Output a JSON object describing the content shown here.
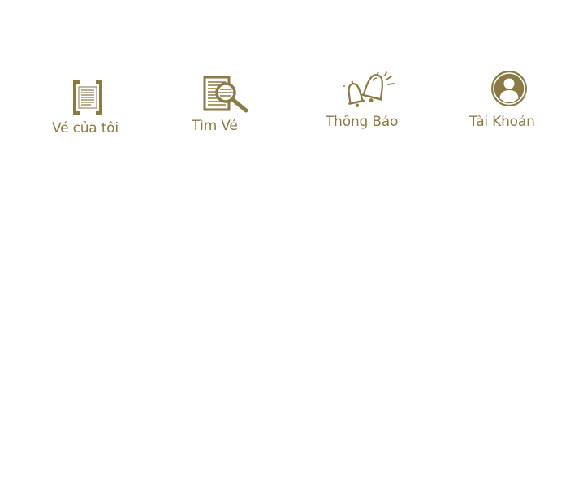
{
  "nav": {
    "items": [
      {
        "label": "Vé của tôi",
        "icon": "ticket-document-icon"
      },
      {
        "label": "Tìm Vé",
        "icon": "search-document-icon"
      },
      {
        "label": "Thông Báo",
        "icon": "bells-icon"
      },
      {
        "label": "Tài Khoản",
        "icon": "account-icon"
      }
    ]
  },
  "colors": {
    "accent": "#8a7a44",
    "background": "#ffffff"
  }
}
